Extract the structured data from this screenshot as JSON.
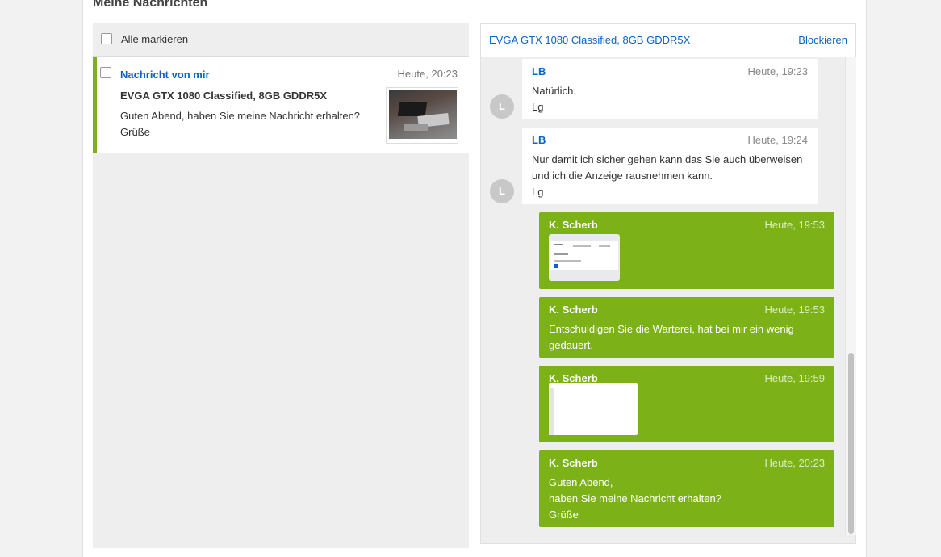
{
  "page": {
    "title": "Meine Nachrichten"
  },
  "left": {
    "select_all_label": "Alle markieren",
    "conversations": [
      {
        "sender": "Nachricht von mir",
        "time": "Heute, 20:23",
        "subject": "EVGA GTX 1080 Classified, 8GB GDDR5X",
        "preview_lines": [
          "Guten Abend, haben Sie meine Nachricht erhalten?",
          "Grüße"
        ],
        "accent_color": "#7cb118"
      }
    ]
  },
  "thread": {
    "title": "EVGA GTX 1080 Classified, 8GB GDDR5X",
    "block_label": "Blockieren",
    "messages": [
      {
        "direction": "in",
        "author": "LB",
        "avatar_letter": "L",
        "time": "Heute, 19:23",
        "lines": [
          "Natürlich.",
          "Lg"
        ]
      },
      {
        "direction": "in",
        "author": "LB",
        "avatar_letter": "L",
        "time": "Heute, 19:24",
        "lines": [
          "Nur damit ich sicher gehen kann das Sie auch überweisen",
          "und ich die Anzeige rausnehmen kann.",
          "Lg"
        ]
      },
      {
        "direction": "out",
        "author": "K. Scherb",
        "time": "Heute, 19:53",
        "attachment": "screenshot-thumbnail"
      },
      {
        "direction": "out",
        "author": "K. Scherb",
        "time": "Heute, 19:53",
        "lines": [
          "Entschuldigen Sie die Warterei, hat bei mir ein wenig",
          "gedauert."
        ]
      },
      {
        "direction": "out",
        "author": "K. Scherb",
        "time": "Heute, 19:59",
        "attachment": "image-thumbnail"
      },
      {
        "direction": "out",
        "author": "K. Scherb",
        "time": "Heute, 20:23",
        "lines": [
          "Guten Abend,",
          "haben Sie meine Nachricht erhalten?",
          "Grüße"
        ]
      }
    ]
  },
  "colors": {
    "link": "#0d62c4",
    "outgoing_bubble": "#7cb118",
    "incoming_bubble": "#ffffff",
    "panel_bg": "#eeeeee"
  }
}
